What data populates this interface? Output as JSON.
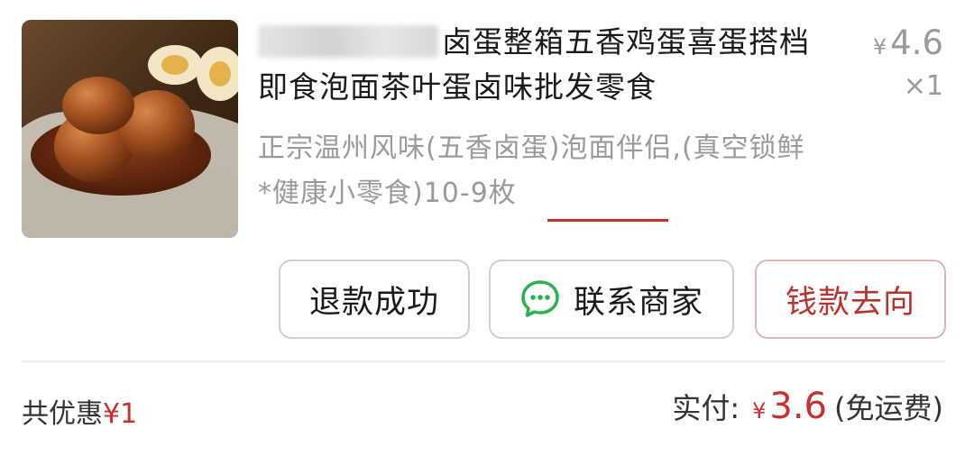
{
  "product": {
    "title_text": "卤蛋整箱五香鸡蛋喜蛋搭档即食泡面茶叶蛋卤味批发零食",
    "spec": "正宗温州风味(五香卤蛋)泡面伴侣,(真空锁鲜*健康小零食)10-9枚",
    "price_symbol": "¥",
    "price": "4.6",
    "quantity": "×1"
  },
  "actions": {
    "refund_label": "退款成功",
    "contact_label": "联系商家",
    "money_label": "钱款去向"
  },
  "summary": {
    "discount_label": "共优惠",
    "discount_amount": "¥1",
    "paid_label": "实付:",
    "paid_symbol": "¥",
    "paid_amount": "3.6",
    "shipping_note": "(免运费)"
  },
  "colors": {
    "accent_red": "#c9302c",
    "chat_green": "#2bb24c"
  },
  "icons": {
    "contact": "chat-bubble-icon"
  }
}
